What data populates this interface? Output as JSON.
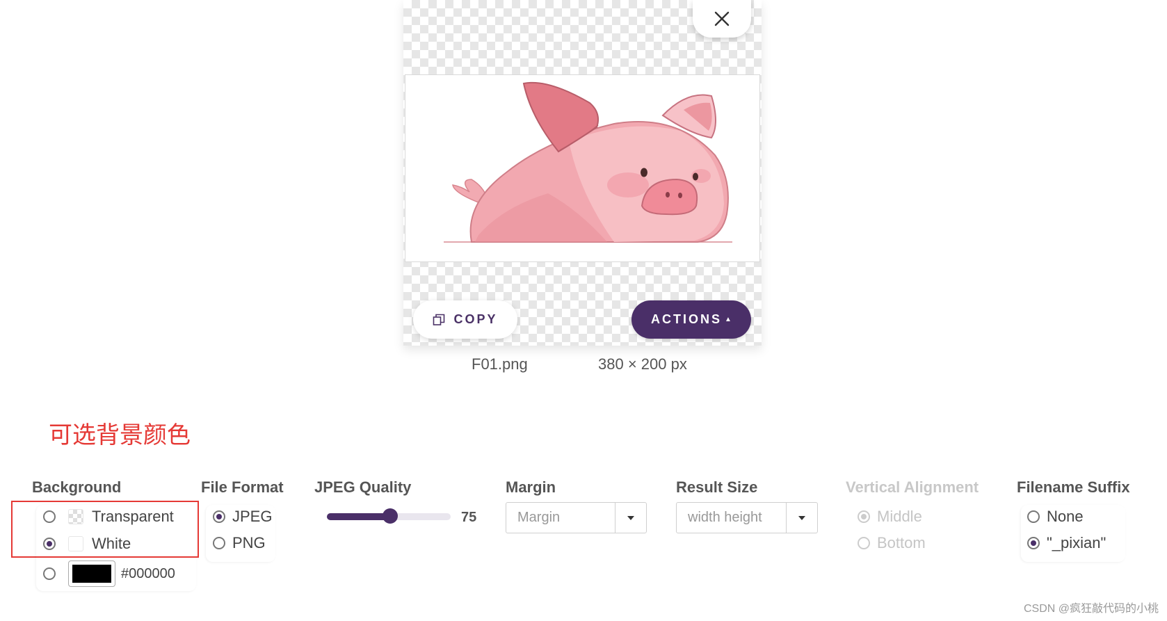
{
  "preview": {
    "copy_label": "COPY",
    "actions_label": "ACTIONS",
    "filename": "F01.png",
    "dimensions": "380 × 200 px"
  },
  "annotation": {
    "text": "可选背景颜色",
    "color": "#e53935"
  },
  "settings": {
    "background": {
      "heading": "Background",
      "options": [
        {
          "label": "Transparent",
          "checked": false
        },
        {
          "label": "White",
          "checked": true
        }
      ],
      "custom_color": "#000000",
      "custom_checked": false
    },
    "file_format": {
      "heading": "File Format",
      "options": [
        {
          "label": "JPEG",
          "checked": true
        },
        {
          "label": "PNG",
          "checked": false
        }
      ]
    },
    "jpeg_quality": {
      "heading": "JPEG Quality",
      "value": "75",
      "fraction": 0.51
    },
    "margin": {
      "heading": "Margin",
      "placeholder": "Margin"
    },
    "result_size": {
      "heading": "Result Size",
      "placeholder": "width height"
    },
    "vertical_alignment": {
      "heading": "Vertical Alignment",
      "disabled": true,
      "options": [
        {
          "label": "Middle",
          "checked": true
        },
        {
          "label": "Bottom",
          "checked": false
        }
      ]
    },
    "filename_suffix": {
      "heading": "Filename Suffix",
      "options": [
        {
          "label": "None",
          "checked": false
        },
        {
          "label": "\"_pixian\"",
          "checked": true
        }
      ]
    }
  },
  "watermark": "CSDN @疯狂敲代码的小桃",
  "colors": {
    "accent": "#4a2f68",
    "pig_pink": "#f2a3ab",
    "pig_ear": "#e07783"
  }
}
